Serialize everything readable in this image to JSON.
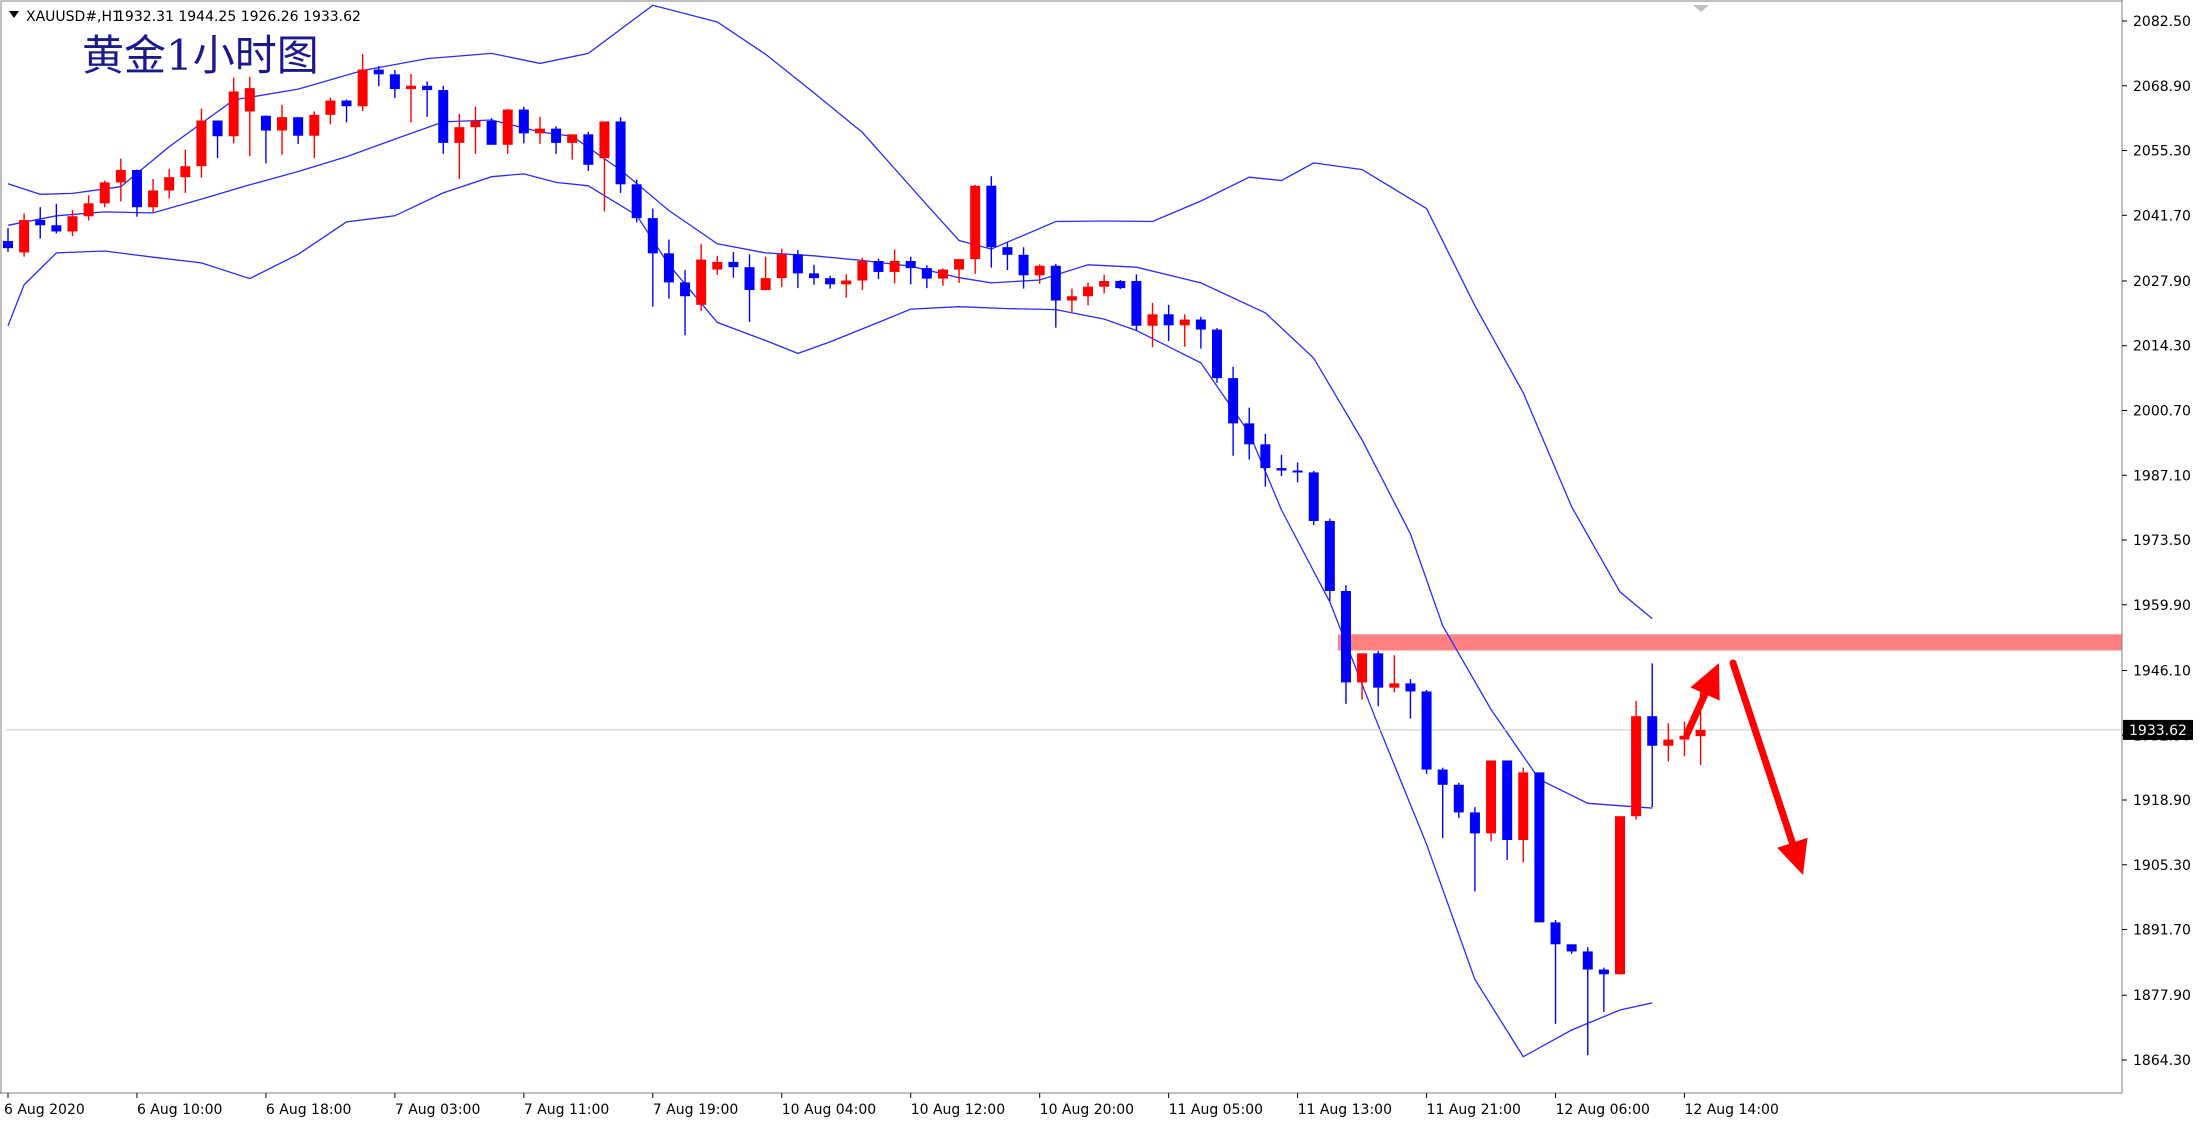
{
  "header": {
    "symbol": "XAUUSD#,H1",
    "ohlc": "1932.31 1944.25 1926.26 1933.62"
  },
  "annotation": {
    "title": "黄金1小时图"
  },
  "colors": {
    "bull": "#ff0000",
    "bear": "#0000ff",
    "band": "#2a2aff",
    "resistance_zone": "#ff8080",
    "arrow": "#ff0000",
    "current_price_line": "#c8c8c8",
    "axis_border": "#000000"
  },
  "chart_data": {
    "type": "candlestick",
    "title": "",
    "ylim": [
      1857.5,
      2089.7
    ],
    "y_ticks": [
      "2082.50",
      "2068.90",
      "2055.30",
      "2041.70",
      "2027.90",
      "2014.30",
      "2000.70",
      "1987.10",
      "1973.50",
      "1959.90",
      "1946.10",
      "1932.50",
      "1918.90",
      "1905.30",
      "1891.70",
      "1877.90",
      "1864.30"
    ],
    "x_ticks": [
      {
        "i": 0,
        "label": "6 Aug 2020"
      },
      {
        "i": 8,
        "label": "6 Aug 10:00"
      },
      {
        "i": 16,
        "label": "6 Aug 18:00"
      },
      {
        "i": 24,
        "label": "7 Aug 03:00"
      },
      {
        "i": 32,
        "label": "7 Aug 11:00"
      },
      {
        "i": 40,
        "label": "7 Aug 19:00"
      },
      {
        "i": 48,
        "label": "10 Aug 04:00"
      },
      {
        "i": 56,
        "label": "10 Aug 12:00"
      },
      {
        "i": 64,
        "label": "10 Aug 20:00"
      },
      {
        "i": 72,
        "label": "11 Aug 05:00"
      },
      {
        "i": 80,
        "label": "11 Aug 13:00"
      },
      {
        "i": 88,
        "label": "11 Aug 21:00"
      },
      {
        "i": 96,
        "label": "12 Aug 06:00"
      },
      {
        "i": 104,
        "label": "12 Aug 14:00"
      }
    ],
    "current_price": "1933.62",
    "resistance_zone": [
      1950.3,
      1953.7
    ],
    "candles": [
      {
        "o": 2036.3,
        "h": 2039.0,
        "l": 2034.0,
        "c": 2034.8
      },
      {
        "o": 2033.9,
        "h": 2042.1,
        "l": 2033.0,
        "c": 2040.7
      },
      {
        "o": 2040.7,
        "h": 2043.4,
        "l": 2036.8,
        "c": 2039.6
      },
      {
        "o": 2039.6,
        "h": 2044.1,
        "l": 2037.9,
        "c": 2038.3
      },
      {
        "o": 2038.3,
        "h": 2042.8,
        "l": 2037.3,
        "c": 2041.5
      },
      {
        "o": 2041.5,
        "h": 2045.9,
        "l": 2040.6,
        "c": 2044.2
      },
      {
        "o": 2044.2,
        "h": 2049.0,
        "l": 2043.4,
        "c": 2048.6
      },
      {
        "o": 2048.6,
        "h": 2053.6,
        "l": 2044.6,
        "c": 2051.2
      },
      {
        "o": 2051.2,
        "h": 2051.3,
        "l": 2041.4,
        "c": 2043.4
      },
      {
        "o": 2043.4,
        "h": 2049.3,
        "l": 2042.4,
        "c": 2046.9
      },
      {
        "o": 2046.9,
        "h": 2051.4,
        "l": 2045.2,
        "c": 2049.7
      },
      {
        "o": 2049.7,
        "h": 2055.5,
        "l": 2046.4,
        "c": 2052.0
      },
      {
        "o": 2052.0,
        "h": 2064.1,
        "l": 2049.6,
        "c": 2061.6
      },
      {
        "o": 2061.6,
        "h": 2061.6,
        "l": 2053.7,
        "c": 2058.3
      },
      {
        "o": 2058.3,
        "h": 2070.6,
        "l": 2056.8,
        "c": 2067.7
      },
      {
        "o": 2063.5,
        "h": 2070.8,
        "l": 2054.1,
        "c": 2068.4
      },
      {
        "o": 2062.6,
        "h": 2062.6,
        "l": 2052.6,
        "c": 2059.5
      },
      {
        "o": 2059.5,
        "h": 2064.9,
        "l": 2054.4,
        "c": 2062.3
      },
      {
        "o": 2062.3,
        "h": 2062.3,
        "l": 2056.7,
        "c": 2058.4
      },
      {
        "o": 2058.4,
        "h": 2063.5,
        "l": 2053.7,
        "c": 2062.8
      },
      {
        "o": 2062.8,
        "h": 2066.4,
        "l": 2060.8,
        "c": 2065.8
      },
      {
        "o": 2065.8,
        "h": 2066.0,
        "l": 2061.2,
        "c": 2064.6
      },
      {
        "o": 2064.6,
        "h": 2075.6,
        "l": 2063.6,
        "c": 2072.3
      },
      {
        "o": 2072.3,
        "h": 2073.0,
        "l": 2068.8,
        "c": 2071.3
      },
      {
        "o": 2071.3,
        "h": 2072.2,
        "l": 2066.3,
        "c": 2068.2
      },
      {
        "o": 2068.2,
        "h": 2071.4,
        "l": 2061.2,
        "c": 2068.9
      },
      {
        "o": 2068.9,
        "h": 2069.8,
        "l": 2062.4,
        "c": 2068.0
      },
      {
        "o": 2068.0,
        "h": 2068.9,
        "l": 2054.6,
        "c": 2056.9
      },
      {
        "o": 2056.9,
        "h": 2063.0,
        "l": 2049.3,
        "c": 2060.2
      },
      {
        "o": 2060.2,
        "h": 2064.5,
        "l": 2054.6,
        "c": 2061.5
      },
      {
        "o": 2061.5,
        "h": 2062.1,
        "l": 2057.1,
        "c": 2056.5
      },
      {
        "o": 2056.5,
        "h": 2064.0,
        "l": 2054.6,
        "c": 2063.9
      },
      {
        "o": 2063.9,
        "h": 2064.5,
        "l": 2056.8,
        "c": 2058.9
      },
      {
        "o": 2058.9,
        "h": 2062.4,
        "l": 2056.7,
        "c": 2059.9
      },
      {
        "o": 2059.9,
        "h": 2060.4,
        "l": 2054.6,
        "c": 2056.9
      },
      {
        "o": 2056.9,
        "h": 2057.4,
        "l": 2053.4,
        "c": 2058.7
      },
      {
        "o": 2058.7,
        "h": 2059.2,
        "l": 2051.0,
        "c": 2052.3
      },
      {
        "o": 2053.7,
        "h": 2061.4,
        "l": 2042.5,
        "c": 2061.4
      },
      {
        "o": 2061.4,
        "h": 2062.3,
        "l": 2046.4,
        "c": 2048.2
      },
      {
        "o": 2048.2,
        "h": 2049.2,
        "l": 2040.2,
        "c": 2041.1
      },
      {
        "o": 2041.1,
        "h": 2043.1,
        "l": 2022.5,
        "c": 2033.7
      },
      {
        "o": 2033.7,
        "h": 2036.6,
        "l": 2024.2,
        "c": 2027.6
      },
      {
        "o": 2027.6,
        "h": 2030.2,
        "l": 2016.5,
        "c": 2024.7
      },
      {
        "o": 2022.9,
        "h": 2035.7,
        "l": 2021.6,
        "c": 2032.4
      },
      {
        "o": 2030.3,
        "h": 2033.2,
        "l": 2029.2,
        "c": 2031.9
      },
      {
        "o": 2031.9,
        "h": 2034.0,
        "l": 2028.6,
        "c": 2030.8
      },
      {
        "o": 2030.8,
        "h": 2033.5,
        "l": 2019.3,
        "c": 2026.0
      },
      {
        "o": 2026.0,
        "h": 2033.0,
        "l": 2025.9,
        "c": 2028.5
      },
      {
        "o": 2028.5,
        "h": 2034.7,
        "l": 2026.6,
        "c": 2033.5
      },
      {
        "o": 2033.5,
        "h": 2034.4,
        "l": 2026.4,
        "c": 2029.5
      },
      {
        "o": 2029.5,
        "h": 2031.3,
        "l": 2027.1,
        "c": 2028.5
      },
      {
        "o": 2028.5,
        "h": 2029.0,
        "l": 2026.3,
        "c": 2027.2
      },
      {
        "o": 2027.2,
        "h": 2029.3,
        "l": 2024.4,
        "c": 2028.0
      },
      {
        "o": 2028.0,
        "h": 2032.8,
        "l": 2026.0,
        "c": 2032.1
      },
      {
        "o": 2032.1,
        "h": 2032.6,
        "l": 2028.3,
        "c": 2029.8
      },
      {
        "o": 2029.8,
        "h": 2034.5,
        "l": 2027.4,
        "c": 2032.1
      },
      {
        "o": 2032.1,
        "h": 2033.0,
        "l": 2027.2,
        "c": 2030.6
      },
      {
        "o": 2030.6,
        "h": 2031.2,
        "l": 2026.4,
        "c": 2028.4
      },
      {
        "o": 2028.4,
        "h": 2030.5,
        "l": 2026.9,
        "c": 2030.3
      },
      {
        "o": 2030.3,
        "h": 2031.4,
        "l": 2027.5,
        "c": 2032.5
      },
      {
        "o": 2032.5,
        "h": 2048.1,
        "l": 2029.4,
        "c": 2047.9
      },
      {
        "o": 2047.9,
        "h": 2049.9,
        "l": 2030.7,
        "c": 2035.0
      },
      {
        "o": 2035.0,
        "h": 2036.1,
        "l": 2030.2,
        "c": 2033.4
      },
      {
        "o": 2033.4,
        "h": 2035.0,
        "l": 2026.3,
        "c": 2029.1
      },
      {
        "o": 2029.1,
        "h": 2031.4,
        "l": 2027.3,
        "c": 2031.1
      },
      {
        "o": 2031.1,
        "h": 2031.5,
        "l": 2018.1,
        "c": 2023.8
      },
      {
        "o": 2023.8,
        "h": 2026.3,
        "l": 2021.4,
        "c": 2024.7
      },
      {
        "o": 2024.7,
        "h": 2027.6,
        "l": 2022.8,
        "c": 2026.7
      },
      {
        "o": 2026.7,
        "h": 2029.2,
        "l": 2025.3,
        "c": 2027.9
      },
      {
        "o": 2027.9,
        "h": 2028.1,
        "l": 2026.2,
        "c": 2026.4
      },
      {
        "o": 2027.9,
        "h": 2029.3,
        "l": 2017.5,
        "c": 2018.5
      },
      {
        "o": 2018.5,
        "h": 2023.3,
        "l": 2014.0,
        "c": 2020.9
      },
      {
        "o": 2020.9,
        "h": 2022.9,
        "l": 2015.3,
        "c": 2018.6
      },
      {
        "o": 2018.6,
        "h": 2020.9,
        "l": 2014.1,
        "c": 2019.8
      },
      {
        "o": 2019.8,
        "h": 2020.4,
        "l": 2013.7,
        "c": 2017.7
      },
      {
        "o": 2017.7,
        "h": 2018.0,
        "l": 2006.5,
        "c": 2007.5
      },
      {
        "o": 2007.5,
        "h": 2009.9,
        "l": 1991.2,
        "c": 1998.0
      },
      {
        "o": 1998.0,
        "h": 2001.3,
        "l": 1990.4,
        "c": 1993.6
      },
      {
        "o": 1993.6,
        "h": 1995.8,
        "l": 1984.7,
        "c": 1988.6
      },
      {
        "o": 1988.6,
        "h": 1991.4,
        "l": 1986.9,
        "c": 1988.1
      },
      {
        "o": 1988.1,
        "h": 1989.8,
        "l": 1985.6,
        "c": 1987.7
      },
      {
        "o": 1987.7,
        "h": 1988.0,
        "l": 1976.6,
        "c": 1977.5
      },
      {
        "o": 1977.5,
        "h": 1978.0,
        "l": 1960.7,
        "c": 1962.8
      },
      {
        "o": 1962.8,
        "h": 1964.0,
        "l": 1939.1,
        "c": 1943.6
      },
      {
        "o": 1943.6,
        "h": 1949.7,
        "l": 1940.0,
        "c": 1949.7
      },
      {
        "o": 1949.7,
        "h": 1950.2,
        "l": 1938.6,
        "c": 1942.5
      },
      {
        "o": 1942.5,
        "h": 1949.3,
        "l": 1941.5,
        "c": 1943.4
      },
      {
        "o": 1943.4,
        "h": 1944.3,
        "l": 1936.0,
        "c": 1941.7
      },
      {
        "o": 1941.7,
        "h": 1942.0,
        "l": 1924.4,
        "c": 1925.3
      },
      {
        "o": 1925.3,
        "h": 1925.7,
        "l": 1910.9,
        "c": 1922.1
      },
      {
        "o": 1922.1,
        "h": 1922.5,
        "l": 1915.1,
        "c": 1916.3
      },
      {
        "o": 1916.3,
        "h": 1917.4,
        "l": 1899.7,
        "c": 1911.9
      },
      {
        "o": 1911.9,
        "h": 1927.2,
        "l": 1910.2,
        "c": 1927.2
      },
      {
        "o": 1927.2,
        "h": 1927.2,
        "l": 1906.3,
        "c": 1910.5
      },
      {
        "o": 1910.5,
        "h": 1925.7,
        "l": 1905.8,
        "c": 1924.7
      },
      {
        "o": 1924.7,
        "h": 1924.7,
        "l": 1893.2,
        "c": 1893.2
      },
      {
        "o": 1893.2,
        "h": 1893.7,
        "l": 1871.9,
        "c": 1888.6
      },
      {
        "o": 1888.6,
        "h": 1888.3,
        "l": 1886.6,
        "c": 1887.1
      },
      {
        "o": 1887.1,
        "h": 1888.0,
        "l": 1865.3,
        "c": 1883.3
      },
      {
        "o": 1883.3,
        "h": 1883.7,
        "l": 1874.4,
        "c": 1882.3
      },
      {
        "o": 1882.3,
        "h": 1915.5,
        "l": 1882.3,
        "c": 1915.5
      },
      {
        "o": 1915.5,
        "h": 1939.7,
        "l": 1914.8,
        "c": 1936.5
      },
      {
        "o": 1936.5,
        "h": 1947.6,
        "l": 1917.4,
        "c": 1930.3
      },
      {
        "o": 1930.3,
        "h": 1935.0,
        "l": 1927.0,
        "c": 1931.6
      },
      {
        "o": 1931.6,
        "h": 1935.4,
        "l": 1928.1,
        "c": 1932.4
      },
      {
        "o": 1932.31,
        "h": 1944.25,
        "l": 1926.26,
        "c": 1933.62
      }
    ],
    "bands": {
      "upper": [
        [
          0,
          2048.3
        ],
        [
          2,
          2046.1
        ],
        [
          4,
          2046.3
        ],
        [
          7,
          2047.7
        ],
        [
          10,
          2056.1
        ],
        [
          14,
          2065.9
        ],
        [
          18,
          2068.2
        ],
        [
          22,
          2072.1
        ],
        [
          26,
          2074.6
        ],
        [
          30,
          2075.7
        ],
        [
          33,
          2073.6
        ],
        [
          36,
          2075.7
        ],
        [
          40,
          2085.8
        ],
        [
          44,
          2082.3
        ],
        [
          47,
          2075.5
        ],
        [
          50,
          2067.4
        ],
        [
          53,
          2059.1
        ],
        [
          57,
          2043.9
        ],
        [
          59,
          2036.4
        ],
        [
          61,
          2034.6
        ],
        [
          65,
          2040.4
        ],
        [
          68,
          2040.5
        ],
        [
          71,
          2040.4
        ],
        [
          74,
          2044.7
        ],
        [
          77,
          2049.7
        ],
        [
          79,
          2049.0
        ],
        [
          81,
          2052.7
        ],
        [
          84,
          2051.3
        ],
        [
          88,
          2043.1
        ],
        [
          91,
          2022.7
        ],
        [
          94,
          2004.4
        ],
        [
          97,
          1980.5
        ],
        [
          100,
          1962.6
        ],
        [
          102,
          1957.0
        ]
      ],
      "middle": [
        [
          0,
          2039.6
        ],
        [
          3,
          2041.6
        ],
        [
          6,
          2042.4
        ],
        [
          9,
          2042.2
        ],
        [
          12,
          2045.1
        ],
        [
          15,
          2048.1
        ],
        [
          18,
          2050.9
        ],
        [
          21,
          2054.0
        ],
        [
          24,
          2057.7
        ],
        [
          27,
          2061.3
        ],
        [
          30,
          2061.7
        ],
        [
          33,
          2059.2
        ],
        [
          35,
          2058.3
        ],
        [
          38,
          2051.2
        ],
        [
          41,
          2042.7
        ],
        [
          44,
          2035.7
        ],
        [
          47,
          2033.8
        ],
        [
          50,
          2033.2
        ],
        [
          53,
          2032.2
        ],
        [
          56,
          2031.0
        ],
        [
          59,
          2028.6
        ],
        [
          61,
          2027.5
        ],
        [
          64,
          2028.1
        ],
        [
          67,
          2031.3
        ],
        [
          70,
          2030.8
        ],
        [
          74,
          2027.5
        ],
        [
          78,
          2021.2
        ],
        [
          81,
          2011.7
        ],
        [
          84,
          1994.5
        ],
        [
          87,
          1974.8
        ],
        [
          89,
          1955.5
        ],
        [
          92,
          1937.9
        ],
        [
          95,
          1923.2
        ],
        [
          98,
          1918.2
        ],
        [
          102,
          1917.2
        ]
      ],
      "lower": [
        [
          0,
          2018.5
        ],
        [
          1,
          2027.1
        ],
        [
          3,
          2033.8
        ],
        [
          6,
          2034.2
        ],
        [
          9,
          2032.9
        ],
        [
          12,
          2031.7
        ],
        [
          15,
          2028.4
        ],
        [
          18,
          2033.5
        ],
        [
          21,
          2040.3
        ],
        [
          24,
          2041.6
        ],
        [
          27,
          2046.4
        ],
        [
          30,
          2049.8
        ],
        [
          32,
          2050.4
        ],
        [
          34,
          2048.6
        ],
        [
          36,
          2047.9
        ],
        [
          39,
          2041.7
        ],
        [
          41,
          2031.3
        ],
        [
          44,
          2019.2
        ],
        [
          47,
          2015.4
        ],
        [
          49,
          2012.7
        ],
        [
          51,
          2015.1
        ],
        [
          54,
          2019.2
        ],
        [
          56,
          2022.0
        ],
        [
          59,
          2022.5
        ],
        [
          62,
          2022.1
        ],
        [
          65,
          2021.9
        ],
        [
          68,
          2019.9
        ],
        [
          70,
          2017.5
        ],
        [
          74,
          2010.7
        ],
        [
          77,
          1996.0
        ],
        [
          79,
          1979.8
        ],
        [
          82,
          1960.5
        ],
        [
          85,
          1934.6
        ],
        [
          88,
          1909.6
        ],
        [
          91,
          1881.2
        ],
        [
          94,
          1865.0
        ],
        [
          97,
          1870.6
        ],
        [
          100,
          1874.8
        ],
        [
          102,
          1876.3
        ]
      ]
    }
  }
}
